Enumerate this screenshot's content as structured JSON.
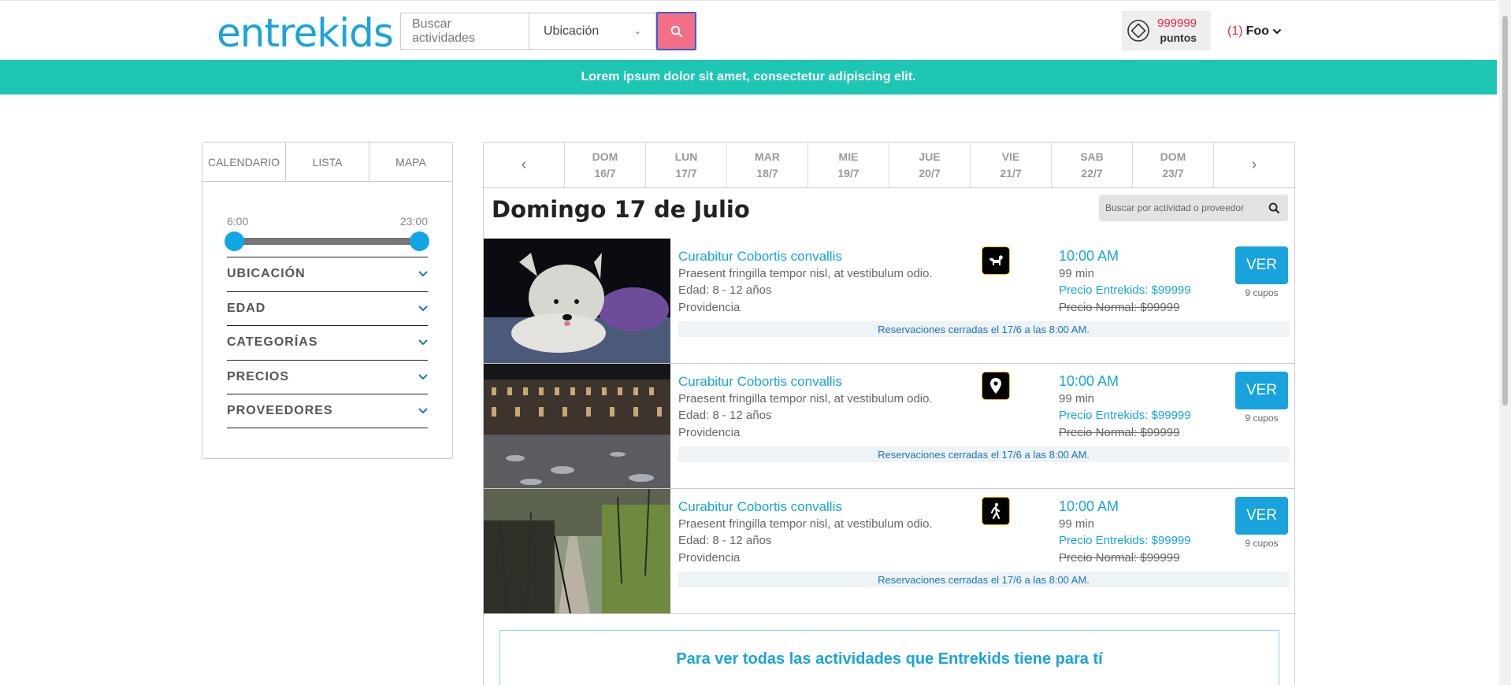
{
  "header": {
    "logo": "entrekids",
    "search_placeholder": "Buscar actividades",
    "location_label": "Ubicación",
    "points_value": "999999",
    "points_label": "puntos",
    "user_count": "(1)",
    "user_name": "Foo"
  },
  "banner": {
    "text": "Lorem ipsum dolor sit amet, consectetur adipiscing elit."
  },
  "sidebar": {
    "tabs": [
      "CALENDARIO",
      "LISTA",
      "MAPA"
    ],
    "time_range": {
      "min_label": "6:00",
      "max_label": "23:00"
    },
    "filters": [
      "UBICACIÓN",
      "EDAD",
      "CATEGORÍAS",
      "PRECIOS",
      "PROVEEDORES"
    ]
  },
  "days": [
    {
      "dow": "DOM",
      "date": "16/7"
    },
    {
      "dow": "LUN",
      "date": "17/7"
    },
    {
      "dow": "MAR",
      "date": "18/7"
    },
    {
      "dow": "MIE",
      "date": "19/7"
    },
    {
      "dow": "JUE",
      "date": "20/7"
    },
    {
      "dow": "VIE",
      "date": "21/7"
    },
    {
      "dow": "SAB",
      "date": "22/7"
    },
    {
      "dow": "DOM",
      "date": "23/7"
    }
  ],
  "nav": {
    "prev": "‹",
    "next": "›"
  },
  "date_title": "Domingo 17 de Julio",
  "activity_search_placeholder": "Buscar por actividad o proveedor",
  "activities": [
    {
      "title": "Curabitur Cobortis convallis",
      "description": "Praesent fringilla tempor nisl, at vestibulum odio.",
      "age": "Edad: 8 - 12 años",
      "location": "Providencia",
      "icon": "dog-icon",
      "time": "10:00 AM",
      "duration": "99 min",
      "price": "Precio Entrekids: $99999",
      "normal_price": "Precio Normal: $99999",
      "button": "VER",
      "spots": "9 cupos",
      "closed_note": "Reservaciones cerradas el 17/6 a las 8:00 AM."
    },
    {
      "title": "Curabitur Cobortis convallis",
      "description": "Praesent fringilla tempor nisl, at vestibulum odio.",
      "age": "Edad: 8 - 12 años",
      "location": "Providencia",
      "icon": "map-pin-icon",
      "time": "10:00 AM",
      "duration": "99 min",
      "price": "Precio Entrekids: $99999",
      "normal_price": "Precio Normal: $99999",
      "button": "VER",
      "spots": "9 cupos",
      "closed_note": "Reservaciones cerradas el 17/6 a las 8:00 AM."
    },
    {
      "title": "Curabitur Cobortis convallis",
      "description": "Praesent fringilla tempor nisl, at vestibulum odio.",
      "age": "Edad: 8 - 12 años",
      "location": "Providencia",
      "icon": "walking-person-icon",
      "time": "10:00 AM",
      "duration": "99 min",
      "price": "Precio Entrekids: $99999",
      "normal_price": "Precio Normal: $99999",
      "button": "VER",
      "spots": "9 cupos",
      "closed_note": "Reservaciones cerradas el 17/6 a las 8:00 AM."
    }
  ],
  "promo": {
    "text": "Para ver todas las actividades que Entrekids tiene para tí"
  },
  "colors": {
    "brand_blue": "#1aa3dd",
    "banner_teal": "#1ec6b4",
    "search_button": "#f26f86",
    "points_red": "#e8283f"
  }
}
